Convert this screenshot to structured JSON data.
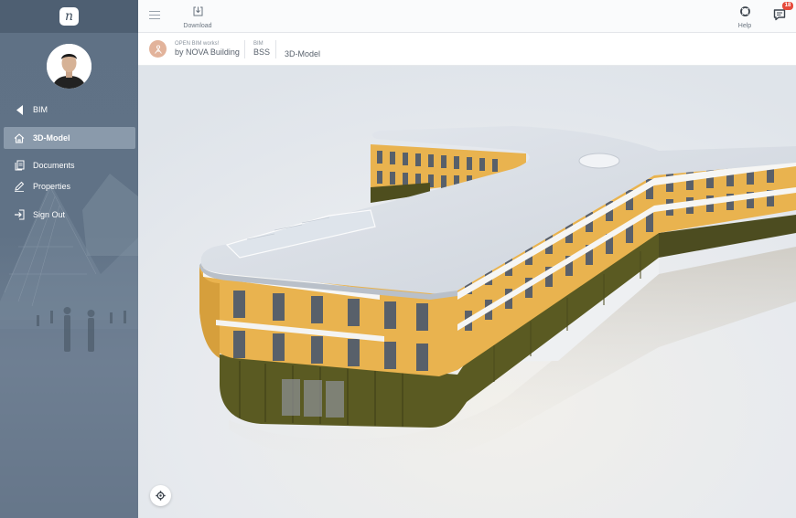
{
  "app": {
    "logo_glyph": "n"
  },
  "sidebar": {
    "items": [
      {
        "label": "BIM",
        "icon": "back-arrow-icon",
        "active": false
      },
      {
        "label": "3D-Model",
        "icon": "home-icon",
        "active": true
      },
      {
        "label": "Documents",
        "icon": "documents-icon",
        "active": false
      },
      {
        "label": "Properties",
        "icon": "pencil-icon",
        "active": false
      },
      {
        "label": "Sign Out",
        "icon": "sign-out-icon",
        "active": false
      }
    ]
  },
  "topbar": {
    "download_label": "Download",
    "help_label": "Help",
    "notification_count": "18"
  },
  "breadcrumb": {
    "project_caption": "OPEN BIM works!",
    "project_name": "by NOVA Building",
    "section_caption": "BIM",
    "section_name": "BSS",
    "page_name": "3D-Model"
  },
  "colors": {
    "sidebar": "#5d6f83",
    "active_item": "#8a9aab",
    "facade_yellow": "#e9b34f",
    "badge": "#e64a3b"
  }
}
